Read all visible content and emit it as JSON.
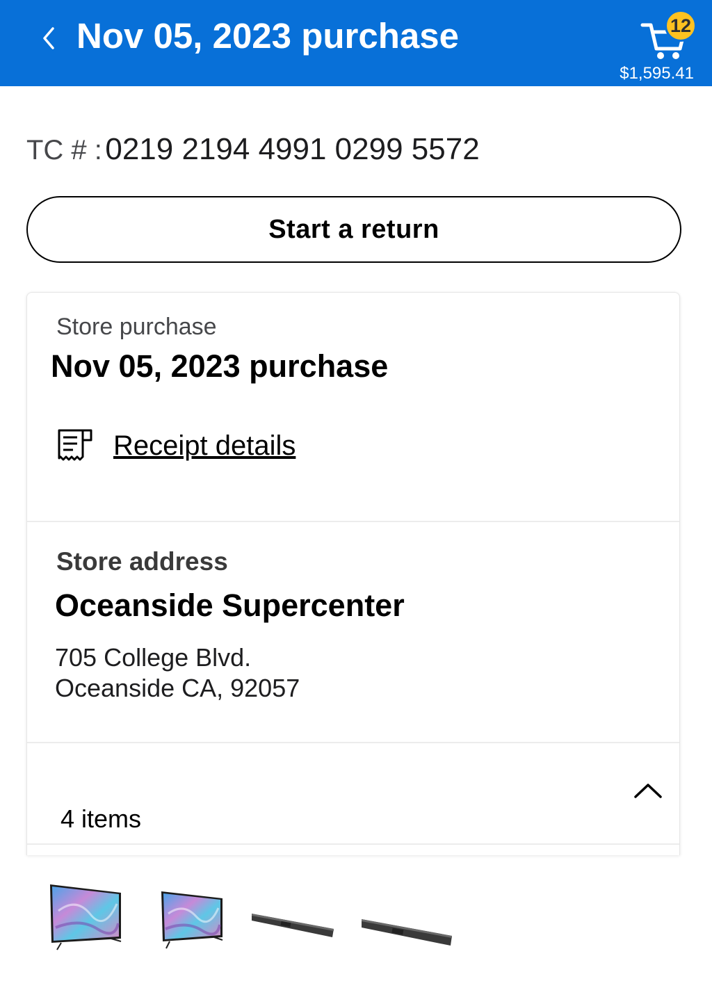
{
  "header": {
    "title": "Nov 05, 2023 purchase",
    "cart_count": "12",
    "cart_total": "$1,595.41",
    "back_icon": "chevron-left-icon",
    "cart_icon": "cart-icon",
    "bg_color": "#0870d8",
    "badge_color": "#ffc220"
  },
  "transaction": {
    "label": "TC # :",
    "number": "0219 2194 4991 0299 5572"
  },
  "return_button": {
    "label": "Start a return"
  },
  "purchase_card": {
    "type_label": "Store purchase",
    "title": "Nov 05, 2023 purchase",
    "receipt_link": "Receipt details",
    "receipt_icon": "receipt-icon"
  },
  "store": {
    "section_label": "Store address",
    "name": "Oceanside Supercenter",
    "address_line1": "705 College Blvd.",
    "address_line2": "Oceanside CA, 92057"
  },
  "items": {
    "count_label": "4 items",
    "collapse_icon": "chevron-up-icon",
    "thumbnails": [
      {
        "kind": "tv-icon"
      },
      {
        "kind": "tv-icon"
      },
      {
        "kind": "soundbar-icon"
      },
      {
        "kind": "soundbar-icon"
      }
    ]
  }
}
